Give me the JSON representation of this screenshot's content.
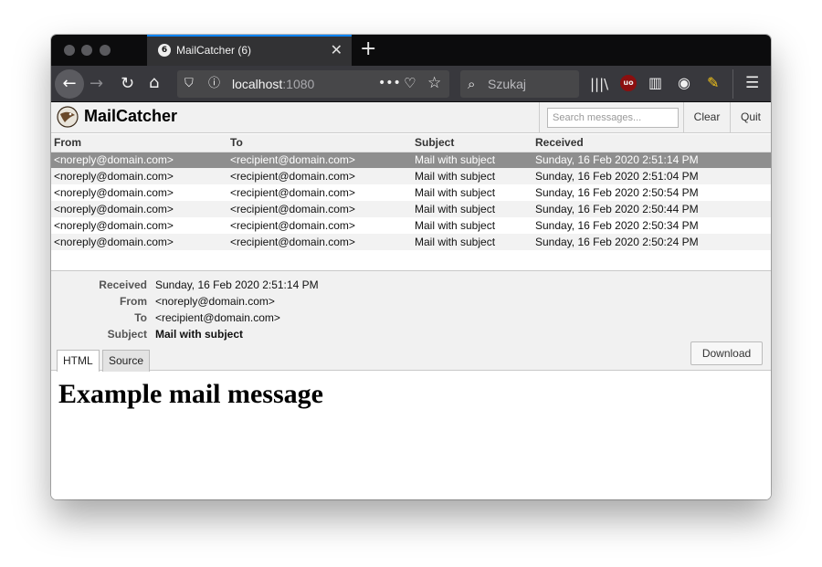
{
  "browser": {
    "tab_title": "MailCatcher (6)",
    "tab_favicon": "6",
    "url_host": "localhost",
    "url_port": ":1080",
    "search_placeholder": "Szukaj",
    "accent_color": "#0a84ff"
  },
  "app": {
    "brand": "MailCatcher",
    "search_placeholder": "Search messages...",
    "clear_label": "Clear",
    "quit_label": "Quit"
  },
  "messages": {
    "columns": [
      "From",
      "To",
      "Subject",
      "Received"
    ],
    "rows": [
      {
        "from": "<noreply@domain.com>",
        "to": "<recipient@domain.com>",
        "subject": "Mail with subject",
        "received": "Sunday, 16 Feb 2020 2:51:14 PM"
      },
      {
        "from": "<noreply@domain.com>",
        "to": "<recipient@domain.com>",
        "subject": "Mail with subject",
        "received": "Sunday, 16 Feb 2020 2:51:04 PM"
      },
      {
        "from": "<noreply@domain.com>",
        "to": "<recipient@domain.com>",
        "subject": "Mail with subject",
        "received": "Sunday, 16 Feb 2020 2:50:54 PM"
      },
      {
        "from": "<noreply@domain.com>",
        "to": "<recipient@domain.com>",
        "subject": "Mail with subject",
        "received": "Sunday, 16 Feb 2020 2:50:44 PM"
      },
      {
        "from": "<noreply@domain.com>",
        "to": "<recipient@domain.com>",
        "subject": "Mail with subject",
        "received": "Sunday, 16 Feb 2020 2:50:34 PM"
      },
      {
        "from": "<noreply@domain.com>",
        "to": "<recipient@domain.com>",
        "subject": "Mail with subject",
        "received": "Sunday, 16 Feb 2020 2:50:24 PM"
      }
    ]
  },
  "details": {
    "received_label": "Received",
    "received": "Sunday, 16 Feb 2020 2:51:14 PM",
    "from_label": "From",
    "from": "<noreply@domain.com>",
    "to_label": "To",
    "to": "<recipient@domain.com>",
    "subject_label": "Subject",
    "subject": "Mail with subject",
    "tabs": [
      "HTML",
      "Source"
    ],
    "download_label": "Download"
  },
  "body": {
    "heading": "Example mail message"
  }
}
